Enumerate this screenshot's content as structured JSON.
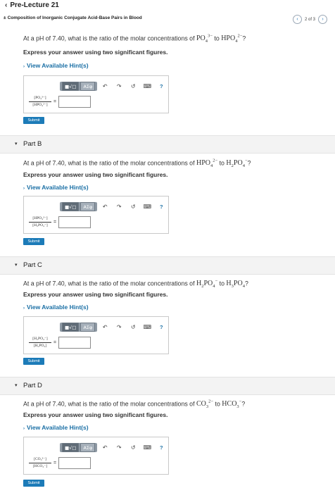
{
  "header": {
    "back_label": "Pre-Lecture 21",
    "subtitle_symbol": "±",
    "subtitle": "Composition of Inorganic Conjugate Acid-Base Pairs in Blood",
    "pager_text": "2 of 3"
  },
  "common": {
    "instruction": "Express your answer using two significant figures.",
    "hint_label": "View Available Hint(s)",
    "submit_label": "Submit",
    "toolbar": {
      "btn_templates": "■√□",
      "btn_greek": "AΣφ",
      "undo": "↶",
      "redo": "↷",
      "reset": "↺",
      "keyboard": "⌨",
      "help": "?"
    }
  },
  "parts": [
    {
      "label": "",
      "q_prefix": "At a pH of 7.40, what is the ratio of the molar concentrations of",
      "q_chem1": "PO4 3-",
      "q_mid": "to",
      "q_chem2": "HPO4 2-",
      "q_suffix": "?",
      "frac_num": "[PO₄³⁻]",
      "frac_den": "[HPO₄²⁻]",
      "equals": "="
    },
    {
      "label": "Part B",
      "q_prefix": "At a pH of 7.40, what is the ratio of the molar concentrations of",
      "q_chem1": "HPO4 2-",
      "q_mid": "to",
      "q_chem2": "H2PO4 -",
      "q_suffix": "?",
      "frac_num": "[HPO₄²⁻]",
      "frac_den": "[H₂PO₄⁻]",
      "equals": "="
    },
    {
      "label": "Part C",
      "q_prefix": "At a pH of 7.40, what is the ratio of the molar concentrations of",
      "q_chem1": "H2PO4 -",
      "q_mid": "to",
      "q_chem2": "H3PO4",
      "q_suffix": "?",
      "frac_num": "[H₂PO₄⁻]",
      "frac_den": "[H₃PO₄]",
      "equals": "="
    },
    {
      "label": "Part D",
      "q_prefix": "At a pH of 7.40, what is the ratio of the molar concentrations of",
      "q_chem1": "CO3 2-",
      "q_mid": "to",
      "q_chem2": "HCO3 -",
      "q_suffix": "?",
      "frac_num": "[CO₃²⁻]",
      "frac_den": "[HCO₃⁻]",
      "equals": "="
    }
  ]
}
